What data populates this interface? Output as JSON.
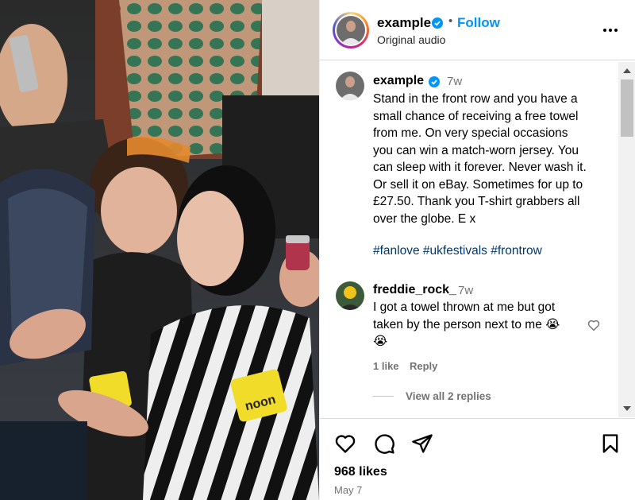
{
  "media": {
    "sponsor_text": "noon"
  },
  "post": {
    "author": "example",
    "follow_label": "Follow",
    "separator": "•",
    "subtitle": "Original audio",
    "more_icon": "more-horizontal-icon"
  },
  "caption": {
    "username": "example",
    "time": "7w",
    "lines": [
      "Stand in the front row and you have a",
      "small chance of receiving a free towel",
      "from me. On very special occasions",
      "you can win a match-worn jersey. You",
      "can sleep with it forever. Never wash it.",
      "Or sell it on eBay. Sometimes for up to",
      "£27.50. Thank you T-shirt grabbers all",
      "over the globe. E x"
    ],
    "hashtags": [
      "#fanlove",
      "#ukfestivals",
      "#frontrow"
    ]
  },
  "comment": {
    "username": "freddie_rock_",
    "time": "7w",
    "lines": [
      "I got a towel thrown at me but got",
      "taken by the person next to me 😭"
    ],
    "line3": "😭",
    "likes": "1 like",
    "reply_label": "Reply",
    "view_replies": "View all 2 replies"
  },
  "actions": {
    "likes": "968 likes",
    "date": "May 7",
    "icons": [
      "heart-icon",
      "comment-icon",
      "share-icon",
      "bookmark-icon"
    ]
  },
  "colors": {
    "accent": "#0095f6",
    "hashtag": "#00376b",
    "muted": "#737373"
  }
}
